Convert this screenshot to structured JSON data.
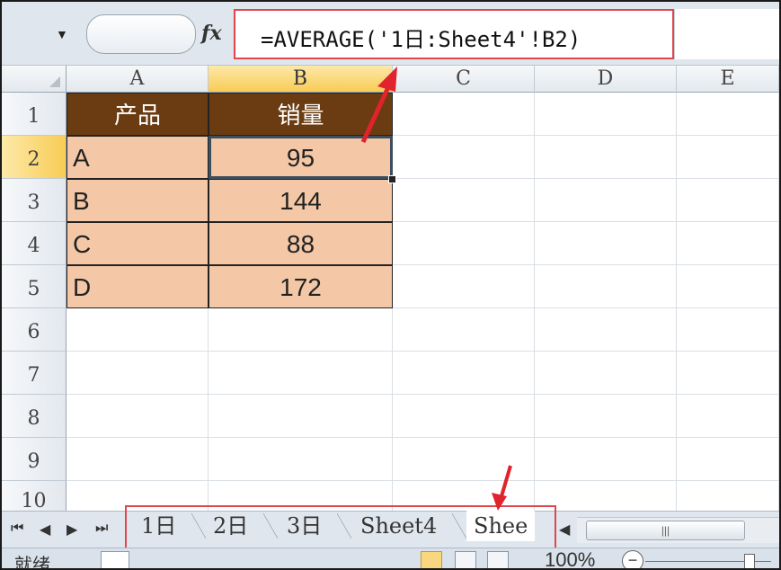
{
  "formula_bar": {
    "fx_label": "fx",
    "formula": "=AVERAGE('1日:Sheet4'!B2)"
  },
  "columns": [
    "A",
    "B",
    "C",
    "D",
    "E"
  ],
  "rows": [
    "1",
    "2",
    "3",
    "4",
    "5",
    "6",
    "7",
    "8",
    "9",
    "10"
  ],
  "table": {
    "headers": [
      "产品",
      "销量"
    ],
    "rows": [
      {
        "product": "A",
        "sales": "95"
      },
      {
        "product": "B",
        "sales": "144"
      },
      {
        "product": "C",
        "sales": "88"
      },
      {
        "product": "D",
        "sales": "172"
      }
    ]
  },
  "sheet_tabs": [
    "1日",
    "2日",
    "3日",
    "Sheet4",
    "Shee"
  ],
  "active_sheet": "Shee",
  "status_bar": {
    "ready": "就绪",
    "zoom": "100%"
  },
  "colors": {
    "header_fill": "#6b3c12",
    "data_fill": "#f4c8a6",
    "highlight_border": "#e0464e"
  }
}
